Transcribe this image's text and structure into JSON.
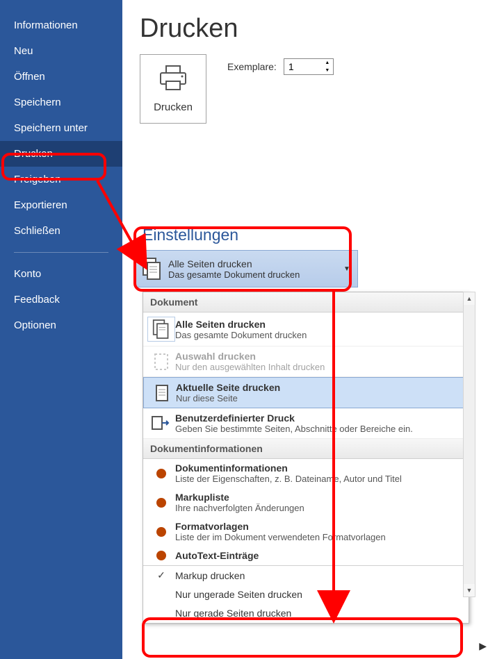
{
  "sidebar": {
    "items": [
      {
        "label": "Informationen"
      },
      {
        "label": "Neu"
      },
      {
        "label": "Öffnen"
      },
      {
        "label": "Speichern"
      },
      {
        "label": "Speichern unter"
      },
      {
        "label": "Drucken",
        "selected": true
      },
      {
        "label": "Freigeben"
      },
      {
        "label": "Exportieren"
      },
      {
        "label": "Schließen"
      }
    ],
    "footer": [
      {
        "label": "Konto"
      },
      {
        "label": "Feedback"
      },
      {
        "label": "Optionen"
      }
    ]
  },
  "page": {
    "title": "Drucken",
    "print_button": "Drucken",
    "copies_label": "Exemplare:",
    "copies_value": "1"
  },
  "settings": {
    "heading": "Einstellungen",
    "selected": {
      "title": "Alle Seiten drucken",
      "sub": "Das gesamte Dokument drucken"
    }
  },
  "dropdown": {
    "section_doc": "Dokument",
    "items_doc": [
      {
        "title": "Alle Seiten drucken",
        "sub": "Das gesamte Dokument drucken",
        "selected": true
      },
      {
        "title": "Auswahl drucken",
        "sub": "Nur den ausgewählten Inhalt drucken",
        "disabled": true
      },
      {
        "title": "Aktuelle Seite drucken",
        "sub": "Nur diese Seite",
        "highlight": true
      },
      {
        "title": "Benutzerdefinierter Druck",
        "sub": "Geben Sie bestimmte Seiten, Abschnitte oder Bereiche ein."
      }
    ],
    "section_info": "Dokumentinformationen",
    "items_info": [
      {
        "title": "Dokumentinformationen",
        "sub": "Liste der Eigenschaften, z. B. Dateiname, Autor und Titel"
      },
      {
        "title": "Markupliste",
        "sub": "Ihre nachverfolgten Änderungen"
      },
      {
        "title": "Formatvorlagen",
        "sub": "Liste der im Dokument verwendeten Formatvorlagen"
      },
      {
        "title": "AutoText-Einträge"
      }
    ],
    "options": [
      {
        "label": "Markup drucken",
        "checked": true
      },
      {
        "label": "Nur ungerade Seiten drucken"
      },
      {
        "label": "Nur gerade Seiten drucken"
      }
    ]
  }
}
